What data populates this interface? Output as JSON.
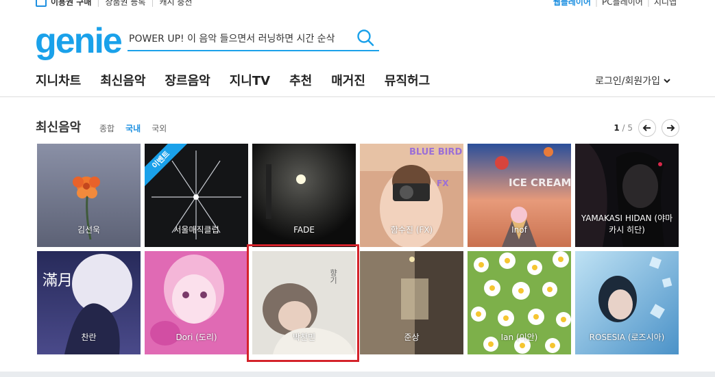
{
  "util": {
    "left": [
      "이용권 구매",
      "상품권 등록",
      "캐시 충전"
    ],
    "right": [
      "웹플레이어",
      "PC플레이어",
      "지니앱"
    ]
  },
  "logo": "genie",
  "search": {
    "value": "POWER UP! 이 음악 들으면서 러닝하면 시간 순삭"
  },
  "nav": [
    "지니차트",
    "최신음악",
    "장르음악",
    "지니TV",
    "추천",
    "매거진",
    "뮤직허그"
  ],
  "login": "로그인/회원가입",
  "section": {
    "title": "최신음악",
    "filters": [
      {
        "label": "종합",
        "active": false
      },
      {
        "label": "국내",
        "active": true
      },
      {
        "label": "국외",
        "active": false
      }
    ],
    "page_current": "1",
    "page_total": "5"
  },
  "event_badge": "이벤트",
  "albums": [
    {
      "artist": "김선욱",
      "art": "flower-gray"
    },
    {
      "artist": "서울매직클럽",
      "art": "star-dark",
      "badge": true
    },
    {
      "artist": "FADE",
      "art": "night-light"
    },
    {
      "artist": "함수진 (FX)",
      "art": "camera-bluebird",
      "cover_text": "BLUE BIRD"
    },
    {
      "artist": "Inof",
      "art": "ice-cream-road",
      "cover_text": "ICE CREAM"
    },
    {
      "artist": "YAMAKASI HIDAN (야마카시 히단)",
      "art": "ink-portrait"
    },
    {
      "artist": "찬란",
      "art": "full-moon",
      "cover_text": "滿月"
    },
    {
      "artist": "Dori (도리)",
      "art": "pink-portrait"
    },
    {
      "artist": "박찬민",
      "art": "soft-portrait",
      "cover_text": "향기"
    },
    {
      "artist": "준상",
      "art": "dim-room"
    },
    {
      "artist": "Ian (이안)",
      "art": "daisies"
    },
    {
      "artist": "ROSESIA (로즈시아)",
      "art": "blue-ice"
    }
  ],
  "colors": {
    "brand": "#1aa1ea",
    "highlight": "#d4222a"
  }
}
